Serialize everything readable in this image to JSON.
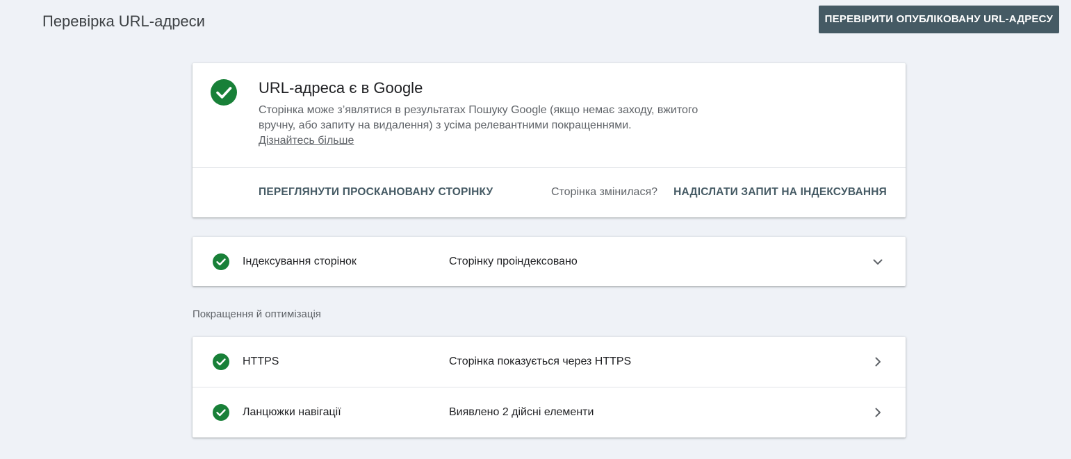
{
  "header": {
    "title": "Перевірка URL-адреси",
    "test_live_button": "ПЕРЕВІРИТИ ОПУБЛІКОВАНУ URL-АДРЕСУ"
  },
  "summary": {
    "title": "URL-адреса є в Google",
    "description": "Сторінка може з’являтися в результатах Пошуку Google (якщо немає заходу, вжитого вручну, або запиту на видалення) з усіма релевантними покращеннями.",
    "learn_more": "Дізнайтесь більше",
    "view_crawled": "ПЕРЕГЛЯНУТИ ПРОСКАНОВАНУ СТОРІНКУ",
    "changed_question": "Сторінка змінилася?",
    "request_indexing": "НАДІСЛАТИ ЗАПИТ НА ІНДЕКСУВАННЯ"
  },
  "indexing": {
    "label": "Індексування сторінок",
    "status": "Сторінку проіндексовано"
  },
  "enhancements": {
    "heading": "Покращення й оптимізація",
    "items": [
      {
        "label": "HTTPS",
        "status": "Сторінка показується через HTTPS"
      },
      {
        "label": "Ланцюжки навігації",
        "status": "Виявлено 2 дійсні елементи"
      }
    ]
  },
  "colors": {
    "success_green": "#188038",
    "button_bg": "#455a64",
    "page_bg": "#eff2f7"
  }
}
